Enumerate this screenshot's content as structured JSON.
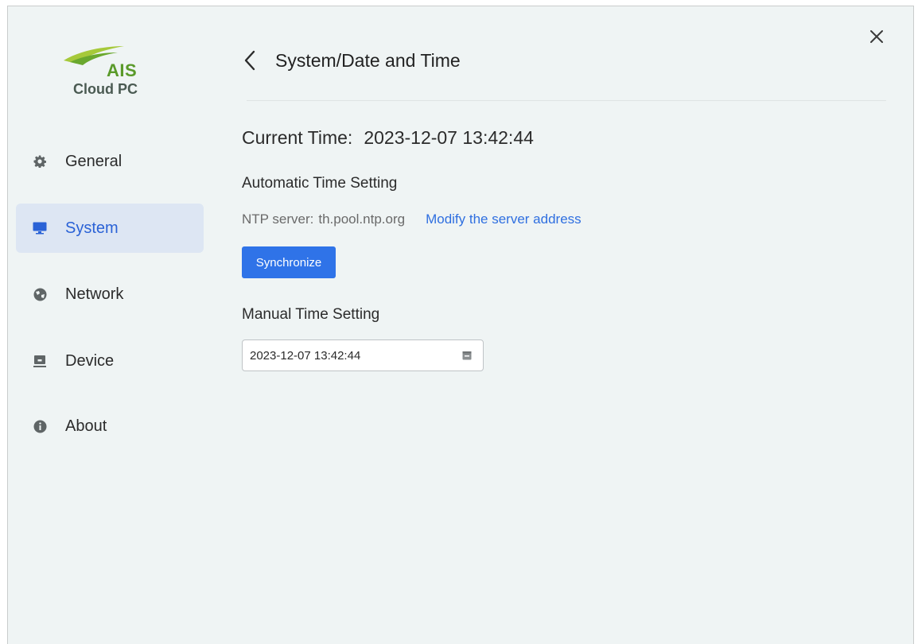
{
  "logo": {
    "brand": "AIS",
    "product": "Cloud PC"
  },
  "sidebar": {
    "items": [
      {
        "label": "General",
        "icon": "gear-icon",
        "active": false
      },
      {
        "label": "System",
        "icon": "monitor-icon",
        "active": true
      },
      {
        "label": "Network",
        "icon": "globe-icon",
        "active": false
      },
      {
        "label": "Device",
        "icon": "device-icon",
        "active": false
      },
      {
        "label": "About",
        "icon": "info-icon",
        "active": false
      }
    ]
  },
  "header": {
    "title": "System/Date and Time"
  },
  "main": {
    "current_time_label": "Current Time:",
    "current_time_value": "2023-12-07 13:42:44",
    "auto_section_title": "Automatic Time Setting",
    "ntp_label": "NTP server:",
    "ntp_value": "th.pool.ntp.org",
    "modify_link": "Modify the server address",
    "sync_button": "Synchronize",
    "manual_section_title": "Manual Time Setting",
    "manual_datetime_value": "2023-12-07 13:42:44"
  },
  "colors": {
    "accent": "#2f73e8",
    "link": "#2f6fe0",
    "active_nav_bg": "#dde6f3",
    "window_bg": "#eff4f4",
    "logo_green": "#5a9a2a"
  }
}
